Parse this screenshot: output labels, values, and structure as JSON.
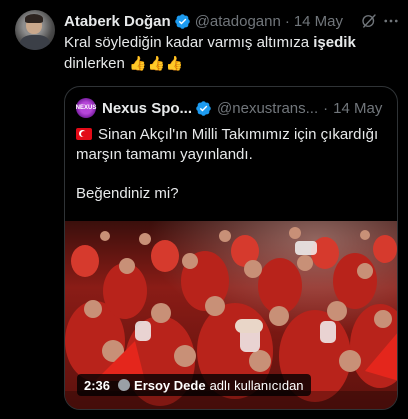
{
  "tweet": {
    "name": "Ataberk Doğan",
    "handle": "@atadogann",
    "separator": "·",
    "time": "14 May",
    "text_before": "Kral söylediğin kadar varmış altımıza ",
    "text_bold": "işedik",
    "text_after": " dinlerken ",
    "emoji": "👍👍👍"
  },
  "quoted": {
    "avatar_text": "NEXUS",
    "name": "Nexus Spo...",
    "handle": "@nexustrans...",
    "separator": "·",
    "time": "14 May",
    "text": "Sinan Akçıl'ın Milli Takımımız için çıkardığı marşın tamamı yayınlandı.",
    "question": "Beğendiniz mi?",
    "video": {
      "duration": "2:36",
      "creator": "Ersoy Dede",
      "suffix": "adlı kullanıcıdan"
    }
  },
  "colors": {
    "background": "#000000",
    "text": "#e7e9ea",
    "secondary": "#71767b",
    "verified": "#1d9bf0",
    "border": "#2f3336"
  },
  "icons": [
    "verified-badge-icon",
    "grok-icon",
    "more-icon",
    "turkish-flag-icon"
  ]
}
